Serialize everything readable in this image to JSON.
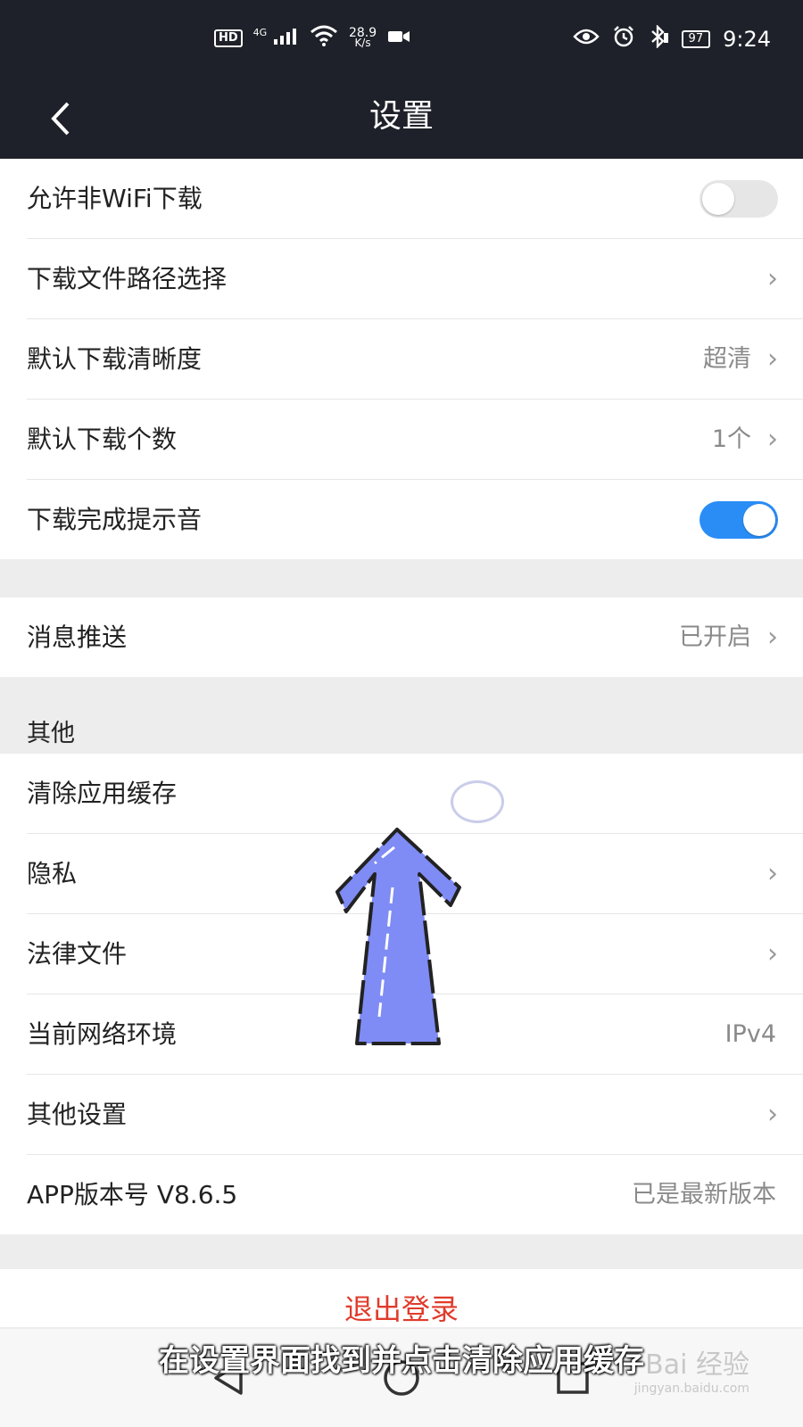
{
  "status_bar": {
    "hd": "HD",
    "network": "4G",
    "speed_value": "28.9",
    "speed_unit": "K/s",
    "battery": "97",
    "time": "9:24"
  },
  "header": {
    "title": "设置"
  },
  "group1": [
    {
      "label": "允许非WiFi下载",
      "toggle": false
    },
    {
      "label": "下载文件路径选择"
    },
    {
      "label": "默认下载清晰度",
      "value": "超清"
    },
    {
      "label": "默认下载个数",
      "value": "1个"
    },
    {
      "label": "下载完成提示音",
      "toggle": true
    }
  ],
  "group2": [
    {
      "label": "消息推送",
      "value": "已开启"
    }
  ],
  "section_other": "其他",
  "group3": [
    {
      "label": "清除应用缓存"
    },
    {
      "label": "隐私"
    },
    {
      "label": "法律文件"
    },
    {
      "label": "当前网络环境",
      "value": "IPv4"
    },
    {
      "label": "其他设置"
    },
    {
      "label": "APP版本号 V8.6.5",
      "value": "已是最新版本"
    }
  ],
  "logout": "退出登录",
  "subtitle": "在设置界面找到并点击清除应用缓存",
  "watermark": {
    "brand": "Bai 经验",
    "url": "jingyan.baidu.com"
  },
  "colors": {
    "header_bg": "#1e2129",
    "toggle_on": "#2a8df5",
    "logout": "#e03b2b",
    "arrow": "#7f8cf5"
  }
}
